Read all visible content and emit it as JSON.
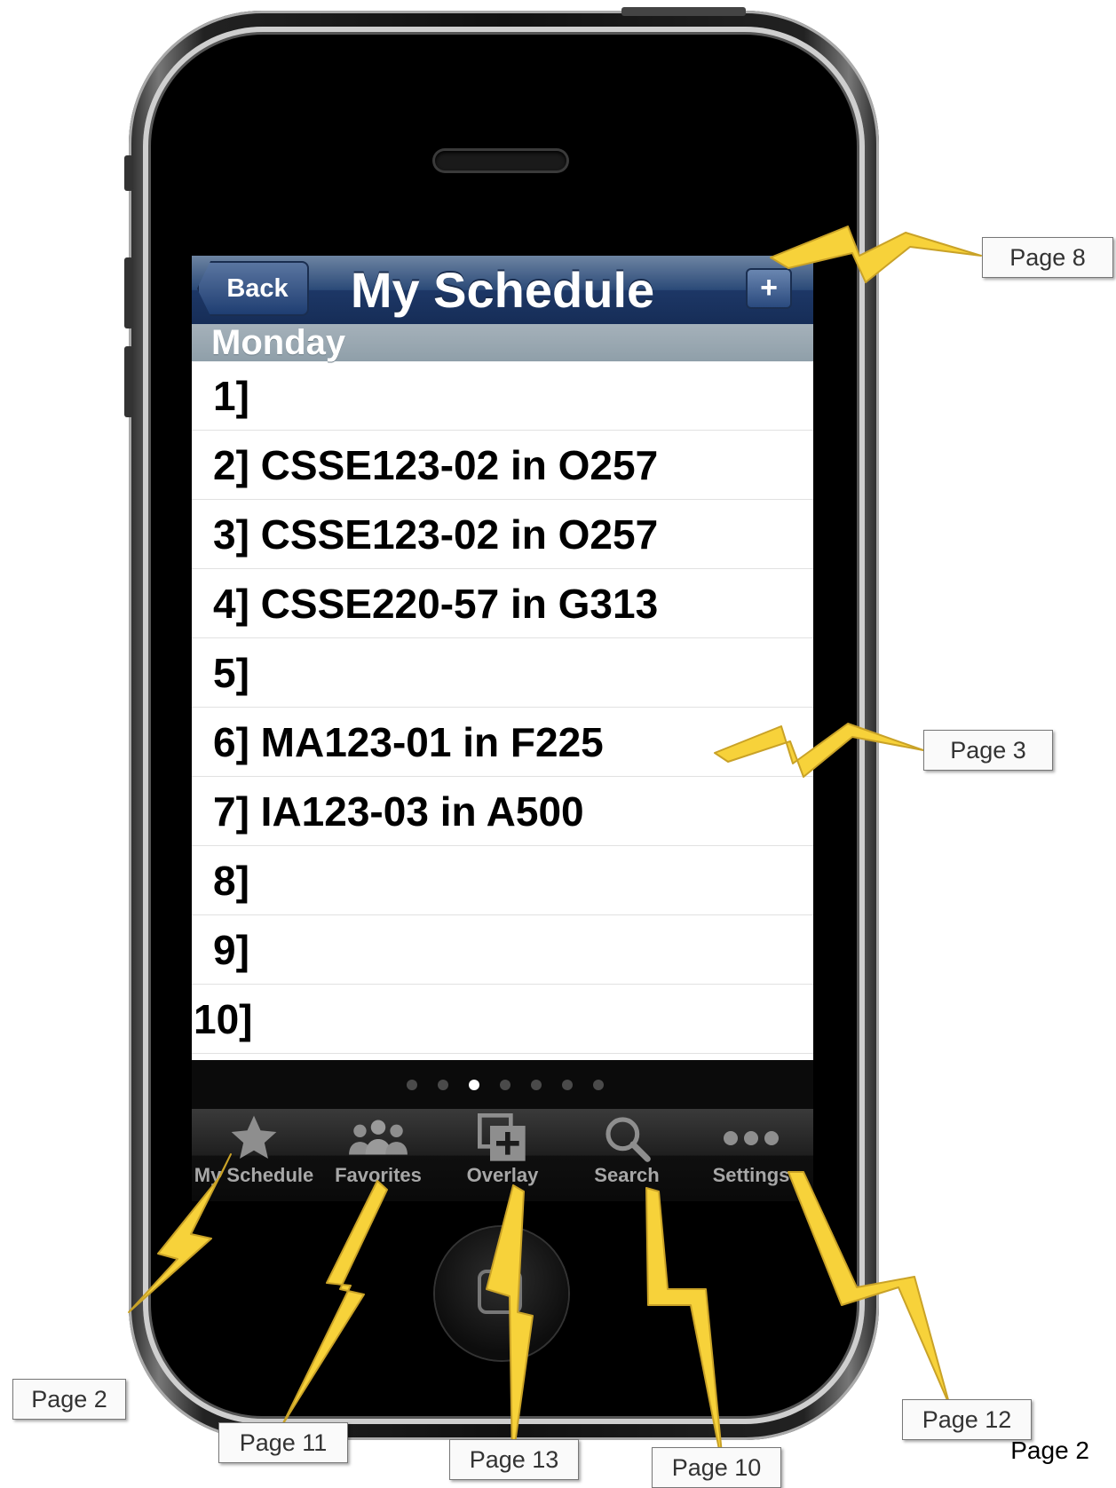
{
  "navbar": {
    "back_label": "Back",
    "title": "My Schedule",
    "add_label": "+"
  },
  "section": {
    "day": "Monday"
  },
  "rows": [
    "1]",
    "2] CSSE123-02 in O257",
    "3] CSSE123-02 in O257",
    "4] CSSE220-57 in G313",
    "5]",
    "6] MA123-01 in F225",
    "7] IA123-03 in A500",
    "8]",
    "9]",
    "10]"
  ],
  "page_control": {
    "count": 7,
    "active_index": 2
  },
  "tabs": [
    {
      "label": "My Schedule",
      "icon": "star-icon"
    },
    {
      "label": "Favorites",
      "icon": "people-icon"
    },
    {
      "label": "Overlay",
      "icon": "overlay-add-icon"
    },
    {
      "label": "Search",
      "icon": "search-icon"
    },
    {
      "label": "Settings",
      "icon": "more-dots-icon"
    }
  ],
  "callouts": {
    "nav": "Page 8",
    "row": "Page 3",
    "my_schedule": "Page 2",
    "favorites": "Page 11",
    "overlay": "Page 13",
    "search": "Page 10",
    "settings": "Page 12"
  },
  "page_number": "Page 2",
  "colors": {
    "navbar": "#2b4a78",
    "section_header": "#9aa8b2",
    "tabbar": "#1a1a1a",
    "callout_bolt": "#f7d23a"
  }
}
